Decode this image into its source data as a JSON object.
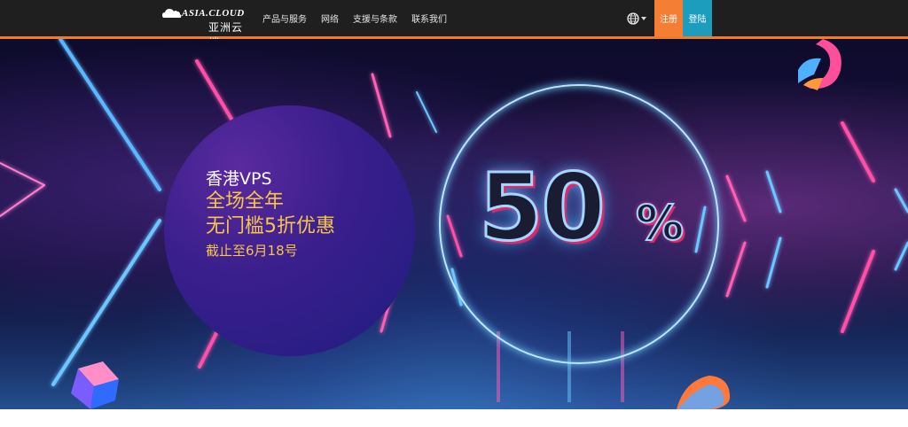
{
  "brand": {
    "logo_en": "ASIA.CLOUD",
    "logo_cn": "亚洲云端"
  },
  "nav": {
    "items": [
      {
        "label": "产品与服务"
      },
      {
        "label": "网络"
      },
      {
        "label": "支援与条款"
      },
      {
        "label": "联系我们"
      }
    ],
    "language_icon": "globe-icon",
    "register_label": "注册",
    "login_label": "登陆"
  },
  "hero": {
    "line1": "香港VPS",
    "line2": "全场全年",
    "line3": "无门槛5折优惠",
    "line4": "截止至6月18号",
    "big_number": "50",
    "percent_sign": "%"
  },
  "colors": {
    "navbar_bg": "#1f1f1f",
    "accent_orange": "#f47e33",
    "accent_blue": "#1d9dbd",
    "promo_gold": "#f6c54a"
  }
}
